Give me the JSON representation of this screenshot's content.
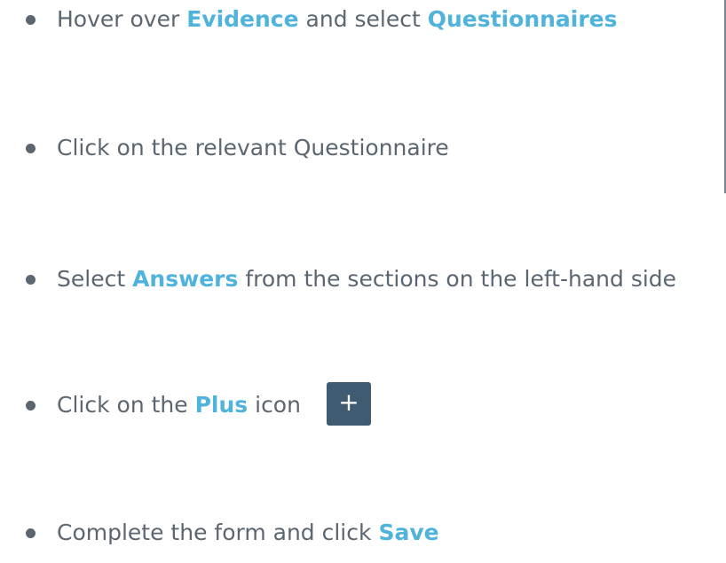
{
  "steps": [
    {
      "prefix": "Hover over ",
      "highlight1": "Evidence",
      "middle": " and select ",
      "highlight2": "Questionnaires"
    },
    {
      "text": "Click on the relevant Questionnaire"
    },
    {
      "prefix": "Select ",
      "highlight": "Answers",
      "suffix": " from the sections on the left-hand side"
    },
    {
      "prefix": "Click on the ",
      "highlight": "Plus",
      "suffix": " icon",
      "button_glyph": "+"
    },
    {
      "prefix": "Complete the form and click ",
      "highlight": "Save"
    }
  ],
  "colors": {
    "text": "#5b6670",
    "highlight": "#4fb3dc",
    "plus_button_bg": "#3f5b72",
    "plus_button_fg": "#ffffff"
  },
  "icons": {
    "bullet": "bullet-dot-icon",
    "plus": "plus-icon"
  }
}
